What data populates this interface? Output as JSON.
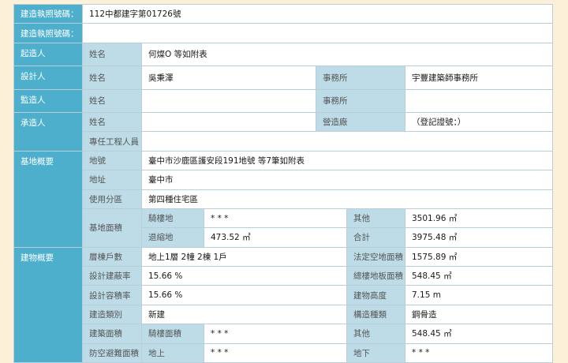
{
  "permit": {
    "number_label": "建造執照號碼：",
    "number_value": "112中都建字第01726號",
    "number_label2": "建造執照號碼：",
    "number_value2": ""
  },
  "applicant": {
    "section": "起造人",
    "name_label": "姓名",
    "name_value": "何燦O 等如附表"
  },
  "designer": {
    "section": "設計人",
    "name_label": "姓名",
    "name_value": "吳秉澤",
    "office_label": "事務所",
    "office_value": "宇豐建築師事務所"
  },
  "supervisor": {
    "section": "監造人",
    "name_label": "姓名",
    "name_value": "",
    "office_label": "事務所",
    "office_value": ""
  },
  "contractor": {
    "section": "承造人",
    "name_label": "姓名",
    "name_value": "",
    "firm_label": "營造廠",
    "firm_value": "（登記證號：）",
    "engineer_label": "專任工程人員",
    "engineer_value": ""
  },
  "site": {
    "section": "基地概要",
    "lot_label": "地號",
    "lot_value": "臺中市沙鹿區護安段191地號 等7筆如附表",
    "address_label": "地址",
    "address_value": "臺中市",
    "zoning_label": "使用分區",
    "zoning_value": "第四種住宅區",
    "area_label": "基地面積",
    "arcade_label": "騎樓地",
    "arcade_value": "* * *",
    "other_label": "其他",
    "other_value": "3501.96 ㎡",
    "setback_label": "退縮地",
    "setback_value": "473.52 ㎡",
    "total_label": "合計",
    "total_value": "3975.48 ㎡"
  },
  "building": {
    "section": "建物概要",
    "floors_label": "層棟戶數",
    "floors_value": "地上1層 2幢 2棟 1戶",
    "legal_open_label": "法定空地面積",
    "legal_open_value": "1575.89 ㎡",
    "coverage_label": "設計建蔽率",
    "coverage_value": "15.66 %",
    "floor_area_label": "總樓地板面積",
    "floor_area_value": "548.45 ㎡",
    "far_label": "設計容積率",
    "far_value": "15.66 %",
    "height_label": "建物高度",
    "height_value": "7.15 m",
    "type_label": "建造類別",
    "type_value": "新建",
    "structure_label": "構造種類",
    "structure_value": "鋼骨造",
    "build_area_label": "建築面積",
    "arcade_area_label": "騎樓面積",
    "arcade_area_value": "* * *",
    "other_label": "其他",
    "other_value": "548.45 ㎡",
    "shelter_label": "防空避難面積",
    "above_label": "地上",
    "above_value": "* * *",
    "below_label": "地下",
    "below_value": "* * *"
  }
}
